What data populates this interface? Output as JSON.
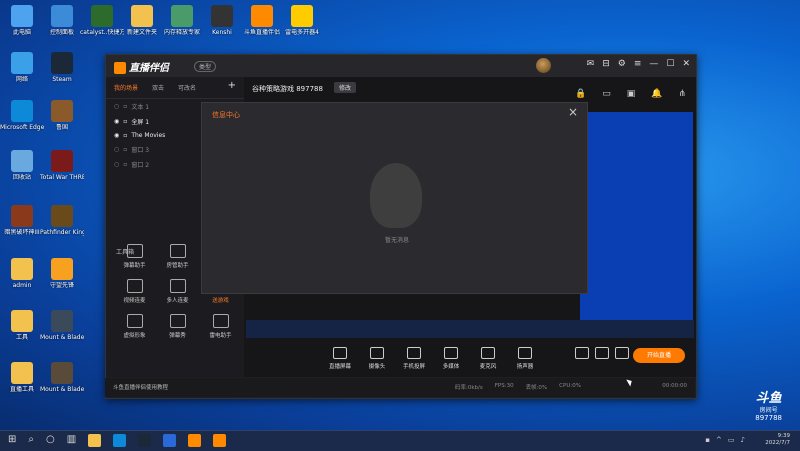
{
  "desktop": {
    "icons": [
      {
        "label": "此电脑",
        "icon": "computer-icon",
        "color": "#4ea3f0"
      },
      {
        "label": "控制面板",
        "icon": "control-panel-icon",
        "color": "#3b8bd8"
      },
      {
        "label": "catalyst..快捷方式",
        "icon": "z-app-icon",
        "color": "#2d6b2d"
      },
      {
        "label": "新建文件夹",
        "icon": "folder-icon",
        "color": "#f2c14e"
      },
      {
        "label": "内存释放专家",
        "icon": "memory-tool-icon",
        "color": "#4a9a6a"
      },
      {
        "label": "Kenshi",
        "icon": "kenshi-icon",
        "color": "#333"
      },
      {
        "label": "斗鱼直播伴侣",
        "icon": "douyu-companion-icon",
        "color": "#ff8a00"
      },
      {
        "label": "雷电多开器4",
        "icon": "ldplayer-icon",
        "color": "#ffcc00"
      },
      {
        "label": "网络",
        "icon": "network-icon",
        "color": "#3aa0e8"
      },
      {
        "label": "Steam",
        "icon": "steam-icon",
        "color": "#1b2838"
      },
      {
        "label": "Microsoft Edge",
        "icon": "edge-icon",
        "color": "#0c8ad8"
      },
      {
        "label": "鲁国",
        "icon": "game-icon",
        "color": "#8a5a2a"
      },
      {
        "label": "回收站",
        "icon": "recycle-bin-icon",
        "color": "#6aa8e0"
      },
      {
        "label": "Total War THREE K...",
        "icon": "total-war-icon",
        "color": "#7a1a1a"
      },
      {
        "label": "暗黑破坏神III",
        "icon": "diablo-icon",
        "color": "#8a3a1a"
      },
      {
        "label": "Pathfinder Kingmaker",
        "icon": "pathfinder-icon",
        "color": "#6a4a1a"
      },
      {
        "label": "admin",
        "icon": "user-folder-icon",
        "color": "#f2c14e"
      },
      {
        "label": "守望先锋",
        "icon": "overwatch-icon",
        "color": "#f8a020"
      },
      {
        "label": "工具",
        "icon": "folder-icon",
        "color": "#f2c14e"
      },
      {
        "label": "Mount & Blade II...",
        "icon": "bannerlord-icon",
        "color": "#3a4a5a"
      },
      {
        "label": "直播工具",
        "icon": "folder-icon",
        "color": "#f2c14e"
      },
      {
        "label": "Mount & Blade II...",
        "icon": "bannerlord-icon",
        "color": "#5a4a3a"
      }
    ]
  },
  "app": {
    "title": "直播伴侣",
    "type_badge": "类型",
    "tabs": [
      "我的场景",
      "双击",
      "可改名"
    ],
    "scenes": [
      {
        "label": "文本 1",
        "on": false
      },
      {
        "label": "全屏 1",
        "on": true
      },
      {
        "label": "The Movies",
        "on": true
      },
      {
        "label": "窗口 3",
        "on": false
      },
      {
        "label": "窗口 2",
        "on": false
      }
    ],
    "tool_section": "工具箱",
    "tools": [
      {
        "label": "弹幕助手",
        "accent": false
      },
      {
        "label": "房管助手",
        "accent": false
      },
      {
        "label": "",
        "accent": false
      },
      {
        "label": "视频连麦",
        "accent": false
      },
      {
        "label": "多人连麦",
        "accent": false
      },
      {
        "label": "送游戏",
        "accent": true
      },
      {
        "label": "虚拟形象",
        "accent": false
      },
      {
        "label": "弹幕秀",
        "accent": false
      },
      {
        "label": "雷电助手",
        "accent": false
      }
    ],
    "room_title": "谷种策略游戏 897788",
    "edit": "修改",
    "dialog": {
      "title": "信息中心",
      "close": "×",
      "empty": "暂无消息"
    },
    "bottom_tools": [
      "直播屏幕",
      "摄像头",
      "手机投屏",
      "多媒体",
      "麦克风",
      "扬声器"
    ],
    "start_live": "开始直播",
    "status": {
      "tip": "斗鱼直播伴侣使用教程",
      "bitrate": "码率:0kb/s",
      "fps": "FPS:30",
      "drop": "丢帧:0%",
      "cpu": "CPU:0%",
      "time": "00:00:00"
    }
  },
  "douyu": {
    "brand": "斗鱼",
    "sub": "房间号",
    "room": "897788"
  },
  "taskbar": {
    "time": "9:39",
    "date": "2022/7/7"
  }
}
